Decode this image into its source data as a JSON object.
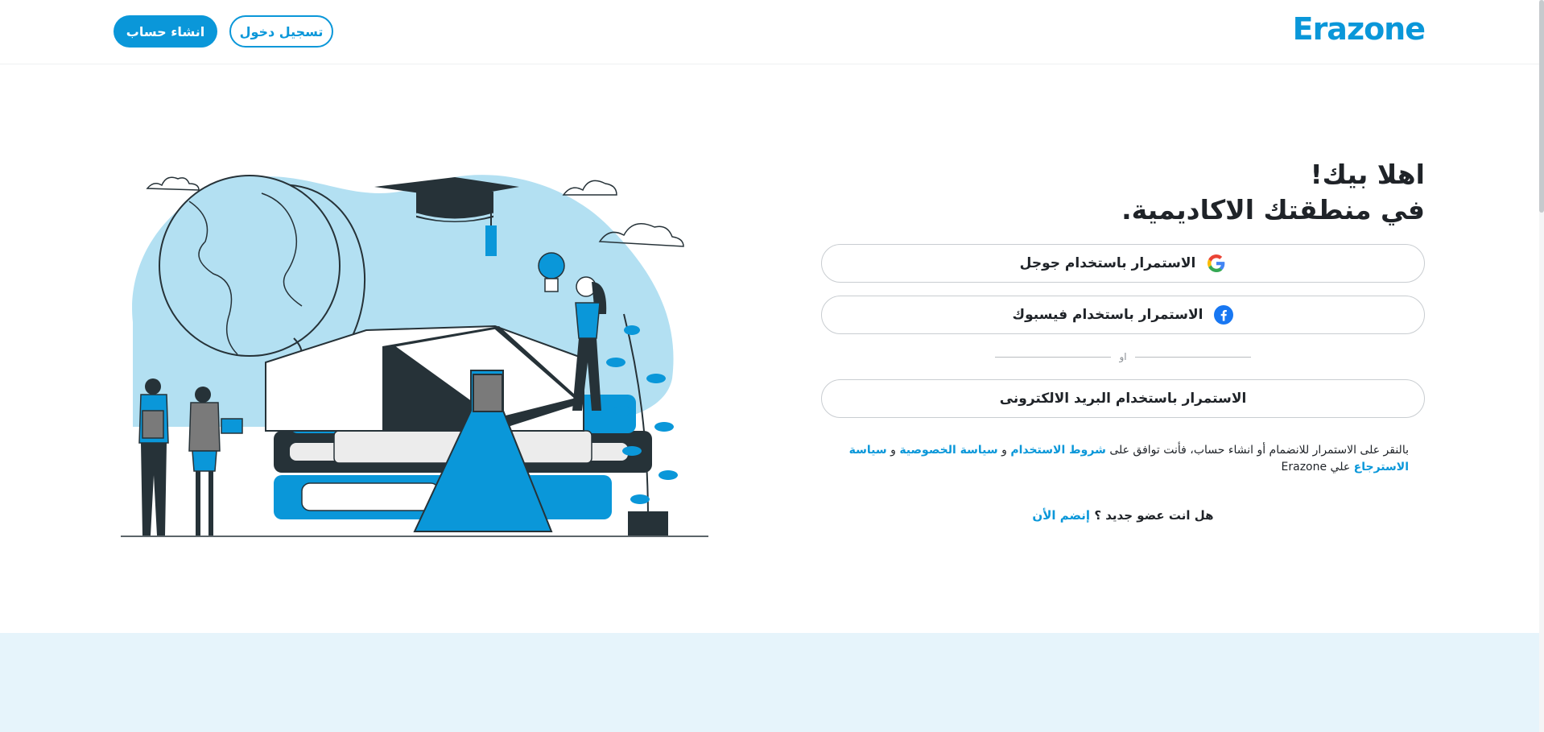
{
  "header": {
    "logo_text": "Erazone",
    "login_label": "تسجيل دخول",
    "register_label": "انشاء حساب"
  },
  "welcome": {
    "line1": "اهلا بيك!",
    "line2": "في منطقتك الاكاديمية."
  },
  "auth": {
    "google_label": "الاستمرار باستخدام جوجل",
    "facebook_label": "الاستمرار باستخدام فيسبوك",
    "or_label": "او",
    "email_label": "الاستمرار باستخدام البريد الالكترونى"
  },
  "terms": {
    "prefix": "بالنقر على الاستمرار للانضمام أو انشاء حساب، فأنت توافق على",
    "terms_link": "شروط الاستخدام",
    "and1": "و",
    "privacy_link": "سياسة الخصوصية",
    "and2": "و",
    "refund_link": "سياسة الاسترجاع",
    "suffix": "علي Erazone"
  },
  "join": {
    "question": "هل انت عضو جديد ؟",
    "link": "إنضم الأن"
  },
  "colors": {
    "accent": "#0a97d9",
    "footer_band": "#e6f4fb",
    "illustration_blob": "#b3e0f2",
    "dark": "#263238"
  },
  "icons": [
    "google-icon",
    "facebook-icon"
  ]
}
